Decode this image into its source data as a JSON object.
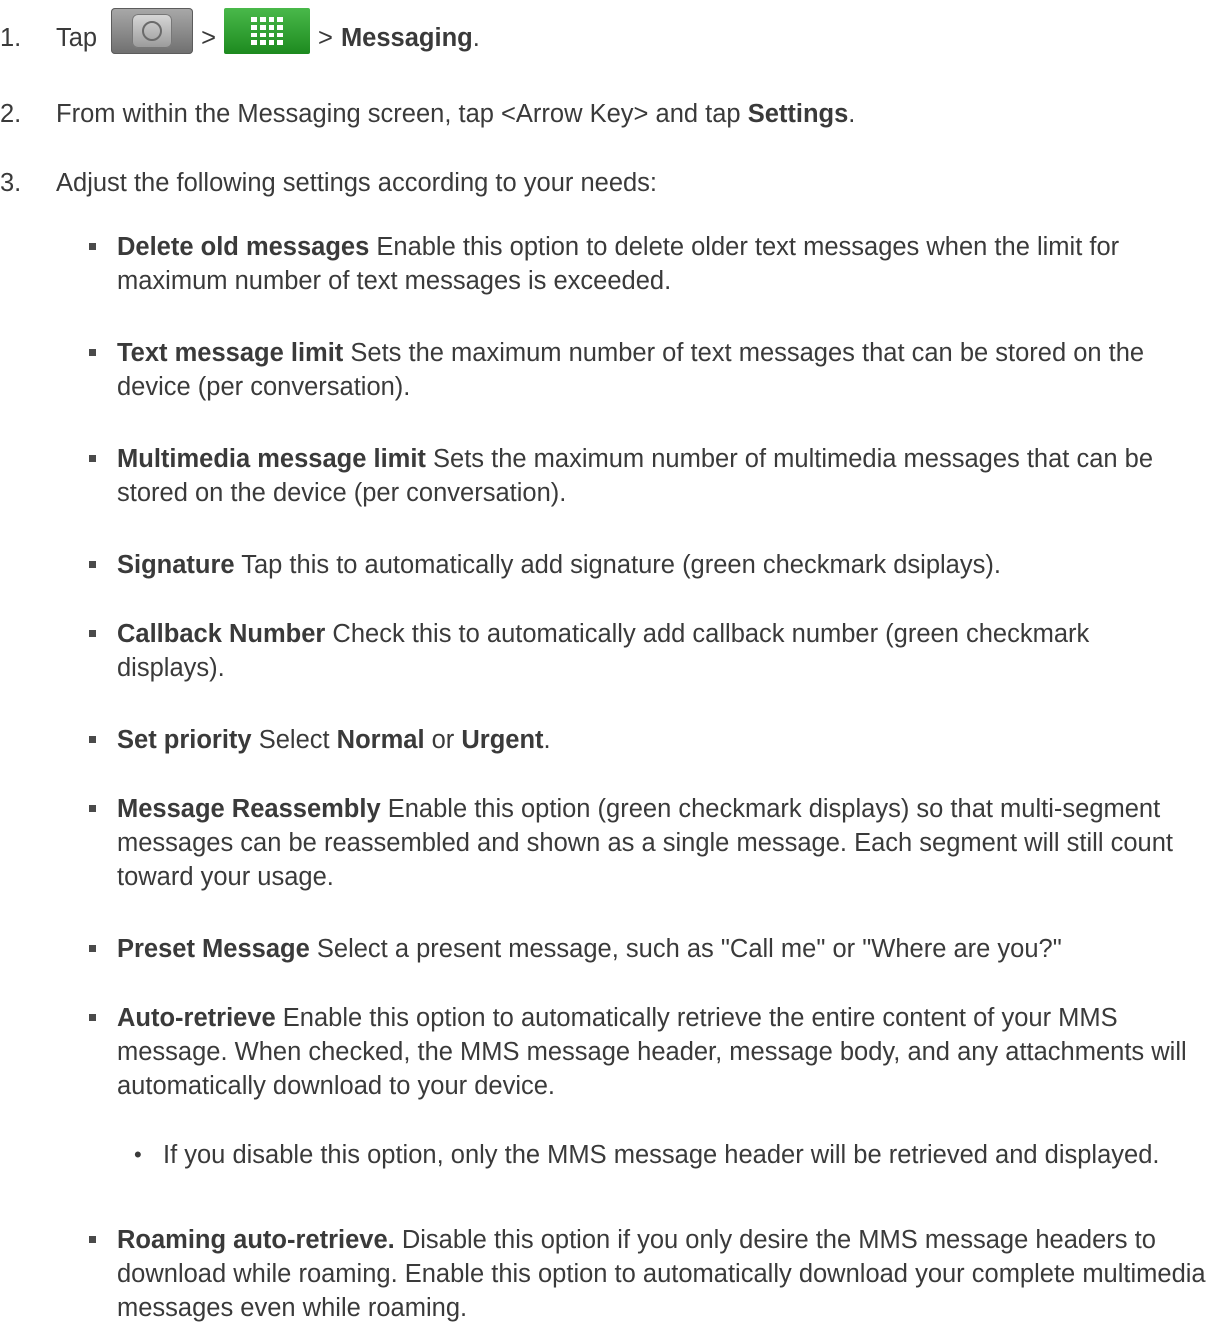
{
  "steps": [
    {
      "num": "1.",
      "tap": "Tap",
      "sep1": ">",
      "sep2": ">",
      "target": "Messaging",
      "end": "."
    },
    {
      "num": "2.",
      "text": "From within the Messaging screen, tap <Arrow Key> and tap ",
      "bold": "Settings",
      "end": "."
    },
    {
      "num": "3.",
      "text": "Adjust the following settings according to your needs:"
    }
  ],
  "icons": [
    "home-icon",
    "applications-icon"
  ],
  "settings": [
    {
      "title": "Delete old messages",
      "desc": " Enable this option to delete older text messages when the limit for maximum number of text messages is exceeded."
    },
    {
      "title": "Text message limit",
      "desc": " Sets the maximum number of text messages that can be stored on the device (per conversation)."
    },
    {
      "title": "Multimedia message limit",
      "desc": " Sets the maximum number of multimedia messages that can be stored on the device (per conversation)."
    },
    {
      "title": "Signature",
      "desc": " Tap this to automatically add signature (green checkmark dsiplays)."
    },
    {
      "title": "Callback Number",
      "desc": " Check this to automatically add callback number (green checkmark displays)."
    },
    {
      "title": "Set priority",
      "desc": " Select ",
      "opt1": "Normal",
      "mid": " or ",
      "opt2": "Urgent",
      "end": "."
    },
    {
      "title": "Message Reassembly",
      "desc": " Enable this option (green checkmark displays) so that multi-segment messages can be reassembled and shown as a single message. Each segment will still count toward your usage."
    },
    {
      "title": "Preset Message",
      "desc": " Select a present message, such as \"Call me\" or \"Where are you?\""
    },
    {
      "title": "Auto-retrieve",
      "desc": " Enable this option to automatically retrieve the entire content of your MMS message. When checked, the MMS message header, message body, and any attachments will automatically download to your device."
    },
    {
      "title": "Roaming auto-retrieve.",
      "desc": " Disable this option if you only desire the MMS message headers to download while roaming. Enable this option to automatically download your complete multimedia messages even while roaming."
    }
  ],
  "sub_bullet": {
    "symbol": "•",
    "text": "If you disable this option, only the MMS message header will be retrieved and displayed."
  },
  "colors": {
    "text": "#3a3a3a",
    "apps_icon_green": "#2a9a2c"
  }
}
